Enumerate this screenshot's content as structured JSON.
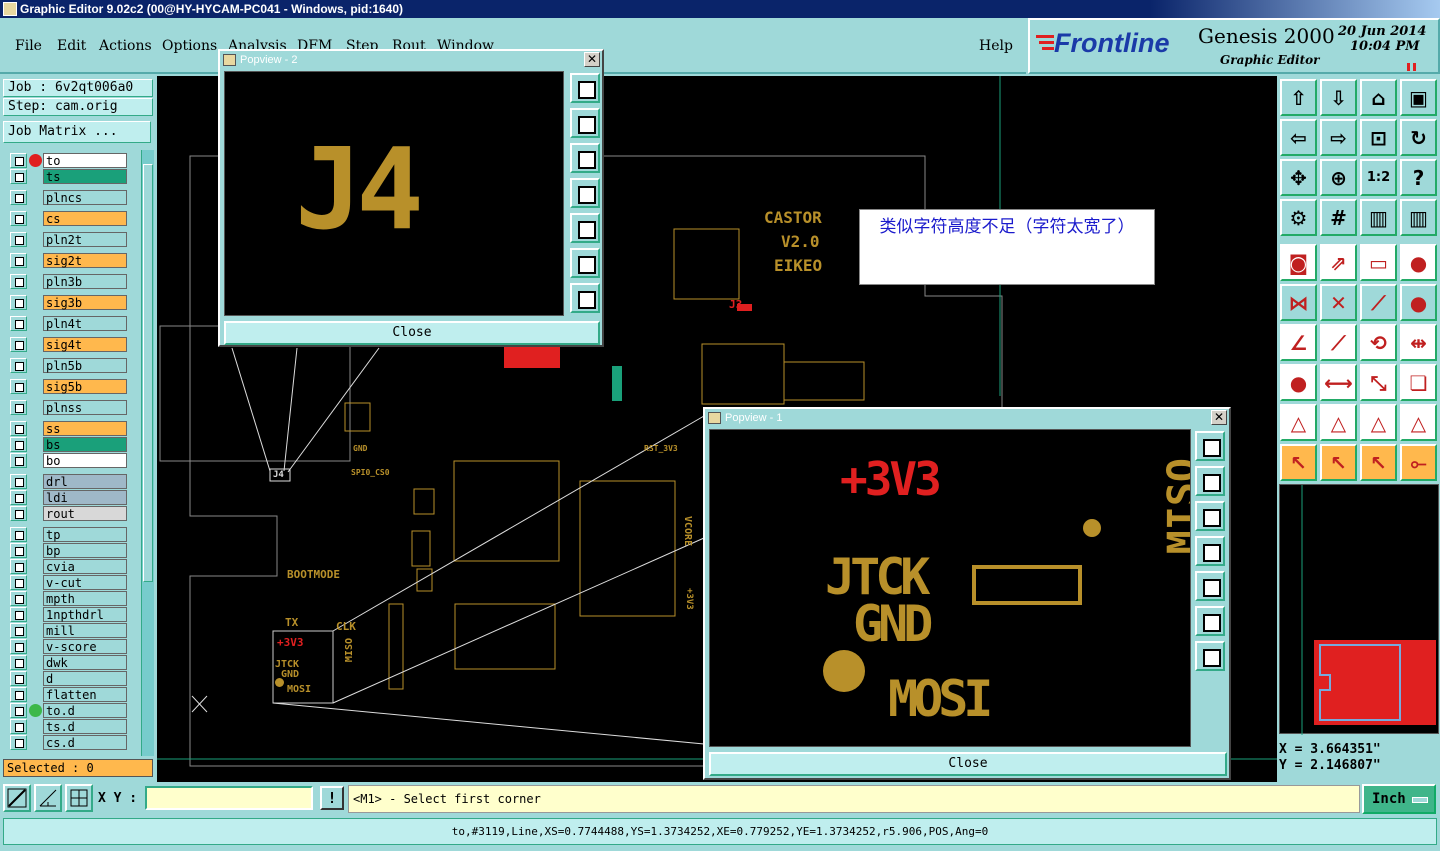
{
  "window": {
    "title": "Graphic Editor 9.02c2 (00@HY-HYCAM-PC041 - Windows, pid:1640)"
  },
  "menu": {
    "file": "File",
    "edit": "Edit",
    "actions": "Actions",
    "options": "Options",
    "analysis": "Analysis",
    "dfm": "DFM",
    "step": "Step",
    "rout": "Rout",
    "window": "Window",
    "help": "Help"
  },
  "brand": {
    "logo": "Frontline",
    "product": "Genesis 2000",
    "subtitle": "Graphic Editor",
    "date": "20 Jun 2014",
    "time": "10:04 PM"
  },
  "job": {
    "job_label": "Job : 6v2qt006a0",
    "step_label": "Step: cam.orig",
    "matrix_button": "Job Matrix ..."
  },
  "layers": [
    {
      "name": "to",
      "color": "#ffffff"
    },
    {
      "name": "ts",
      "color": "#1aa07a"
    },
    {
      "name": "plncs",
      "color": "#9fd9d9"
    },
    {
      "name": "cs",
      "color": "#ffb84d"
    },
    {
      "name": "pln2t",
      "color": "#9fd9d9"
    },
    {
      "name": "sig2t",
      "color": "#ffb84d"
    },
    {
      "name": "pln3b",
      "color": "#9fd9d9"
    },
    {
      "name": "sig3b",
      "color": "#ffb84d"
    },
    {
      "name": "pln4t",
      "color": "#9fd9d9"
    },
    {
      "name": "sig4t",
      "color": "#ffb84d"
    },
    {
      "name": "pln5b",
      "color": "#9fd9d9"
    },
    {
      "name": "sig5b",
      "color": "#ffb84d"
    },
    {
      "name": "plnss",
      "color": "#9fd9d9"
    },
    {
      "name": "ss",
      "color": "#ffb84d"
    },
    {
      "name": "bs",
      "color": "#1aa07a"
    },
    {
      "name": "bo",
      "color": "#ffffff"
    },
    {
      "name": "drl",
      "color": "#9fb8c8"
    },
    {
      "name": "ldi",
      "color": "#9fb8c8"
    },
    {
      "name": "rout",
      "color": "#d8d8d8"
    },
    {
      "name": "tp",
      "color": "#9fd9d9"
    },
    {
      "name": "bp",
      "color": "#9fd9d9"
    },
    {
      "name": "cvia",
      "color": "#9fd9d9"
    },
    {
      "name": "v-cut",
      "color": "#9fd9d9"
    },
    {
      "name": "mpth",
      "color": "#9fd9d9"
    },
    {
      "name": "1npthdrl",
      "color": "#9fd9d9"
    },
    {
      "name": "mill",
      "color": "#9fd9d9"
    },
    {
      "name": "v-score",
      "color": "#9fd9d9"
    },
    {
      "name": "dwk",
      "color": "#9fd9d9"
    },
    {
      "name": "d",
      "color": "#9fd9d9"
    },
    {
      "name": "flatten",
      "color": "#9fd9d9"
    },
    {
      "name": "to.d",
      "color": "#9fd9d9"
    },
    {
      "name": "ts.d",
      "color": "#9fd9d9"
    },
    {
      "name": "cs.d",
      "color": "#9fd9d9"
    }
  ],
  "selected": "Selected : 0",
  "popview2": {
    "title": "Popview - 2",
    "text": "J4",
    "close": "Close"
  },
  "popview1": {
    "title": "Popview - 1",
    "close": "Close",
    "texts": {
      "v33": "+3V3",
      "jtck": "JTCK",
      "gnd": "GND",
      "mosi": "MOSI",
      "side": "MISO"
    }
  },
  "annotation": "类似字符高度不足（字符太宽了）",
  "board": {
    "castor": "CASTOR",
    "ver": "V2.0",
    "eikeo": "EIKEO",
    "j3": "J3",
    "j4": "J4",
    "bootmode": "BOOTMODE",
    "tx": "TX",
    "clk": "CLK",
    "miso": "MISO",
    "gnd": "GND",
    "spi": "SPI0_CS0",
    "rst": "RST_3V3",
    "vcore": "VCORE",
    "v33": "+3V3",
    "tv33": "+3V3",
    "tjtck": "JTCK",
    "tgnd": "GND",
    "tmosi": "MOSI"
  },
  "coords": {
    "x": "X = 3.664351\"",
    "y": "Y = 2.146807\""
  },
  "bottom": {
    "xy_label": "X Y :",
    "xy_value": "",
    "prompt": "<M1> - Select first corner",
    "units": "Inch",
    "status": "to,#3119,Line,XS=0.7744488,YS=1.3734252,XE=0.779252,YE=1.3734252,r5.906,POS,Ang=0"
  },
  "colors": {
    "background": "#9fd9d9",
    "canvas": "#000000",
    "silk": "#b8902a",
    "highlight": "#e02020"
  }
}
